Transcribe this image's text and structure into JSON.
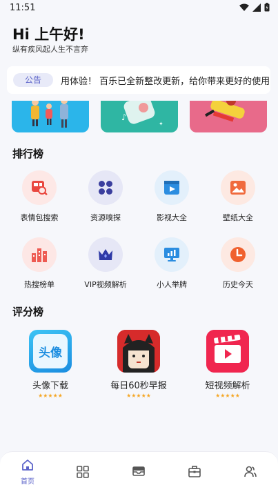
{
  "status_bar": {
    "time": "11:51"
  },
  "header": {
    "greeting": "Hi 上午好!",
    "subtitle": "纵有疾风起人生不言弃"
  },
  "notice": {
    "tag": "公告",
    "text": "用体验！   百乐已全新整改更新，给你带来更好的使用"
  },
  "ranking": {
    "title": "排行榜",
    "items": [
      {
        "label": "表情包搜索",
        "icon": "search-image-icon",
        "color": "#e9473f",
        "bg": "#fde8e6"
      },
      {
        "label": "资源嗅探",
        "icon": "clover-icon",
        "color": "#3b3f9e",
        "bg": "#e6e7f6"
      },
      {
        "label": "影视大全",
        "icon": "video-play-icon",
        "color": "#2b8de0",
        "bg": "#e3f0fb"
      },
      {
        "label": "壁纸大全",
        "icon": "picture-icon",
        "color": "#f06a3d",
        "bg": "#fde9e2"
      },
      {
        "label": "热搜榜单",
        "icon": "bar-chart-icon",
        "color": "#ee5a52",
        "bg": "#fde7e5"
      },
      {
        "label": "VIP视频解析",
        "icon": "crown-icon",
        "color": "#2f3aa6",
        "bg": "#e6e7f6"
      },
      {
        "label": "小人举牌",
        "icon": "signboard-icon",
        "color": "#2b8de0",
        "bg": "#e3f0fb"
      },
      {
        "label": "历史今天",
        "icon": "clock-icon",
        "color": "#f0612e",
        "bg": "#fde9e2"
      }
    ]
  },
  "rating": {
    "title": "评分榜",
    "apps": [
      {
        "label": "头像下载",
        "stars": "★★★★★",
        "icon": "avatar-app-icon",
        "icon_text": "头像"
      },
      {
        "label": "每日60秒早报",
        "stars": "★★★★★",
        "icon": "cartoon-girl-app-icon"
      },
      {
        "label": "短视频解析",
        "stars": "★★★★★",
        "icon": "clapperboard-app-icon"
      }
    ]
  },
  "tabbar": {
    "items": [
      {
        "label": "首页",
        "icon": "home-icon",
        "active": true
      },
      {
        "label": "",
        "icon": "grid-icon"
      },
      {
        "label": "",
        "icon": "mail-icon"
      },
      {
        "label": "",
        "icon": "briefcase-icon"
      },
      {
        "label": "",
        "icon": "users-icon"
      }
    ]
  },
  "colors": {
    "accent": "#5b63c9",
    "star": "#f5a623"
  }
}
